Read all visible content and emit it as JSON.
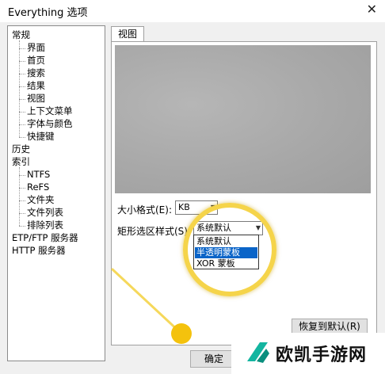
{
  "window": {
    "title": "Everything 选项",
    "close_glyph": "✕"
  },
  "tree": {
    "items": [
      {
        "label": "常规",
        "level": 0
      },
      {
        "label": "界面",
        "level": 1
      },
      {
        "label": "首页",
        "level": 1
      },
      {
        "label": "搜索",
        "level": 1
      },
      {
        "label": "结果",
        "level": 1
      },
      {
        "label": "视图",
        "level": 1
      },
      {
        "label": "上下文菜单",
        "level": 1
      },
      {
        "label": "字体与颜色",
        "level": 1
      },
      {
        "label": "快捷键",
        "level": 1
      },
      {
        "label": "历史",
        "level": 0
      },
      {
        "label": "索引",
        "level": 0
      },
      {
        "label": "NTFS",
        "level": 1
      },
      {
        "label": "ReFS",
        "level": 1
      },
      {
        "label": "文件夹",
        "level": 1
      },
      {
        "label": "文件列表",
        "level": 1
      },
      {
        "label": "排除列表",
        "level": 1
      },
      {
        "label": "ETP/FTP 服务器",
        "level": 0
      },
      {
        "label": "HTTP 服务器",
        "level": 0
      }
    ]
  },
  "tab": {
    "label": "视图"
  },
  "size_format": {
    "label": "大小格式(E):",
    "value": "KB"
  },
  "rect_style": {
    "label": "矩形选区样式(S):",
    "value": "系统默认",
    "options": [
      "系统默认",
      "半透明蒙板",
      "XOR 蒙板"
    ],
    "highlighted": "半透明蒙板"
  },
  "buttons": {
    "restore": "恢复到默认(R)",
    "ok": "确定"
  },
  "watermark": {
    "text": "欧凯手游网"
  },
  "colors": {
    "highlight": "#0a64c8",
    "annotation": "#f5d44a",
    "preview": "#aaaaaa"
  }
}
